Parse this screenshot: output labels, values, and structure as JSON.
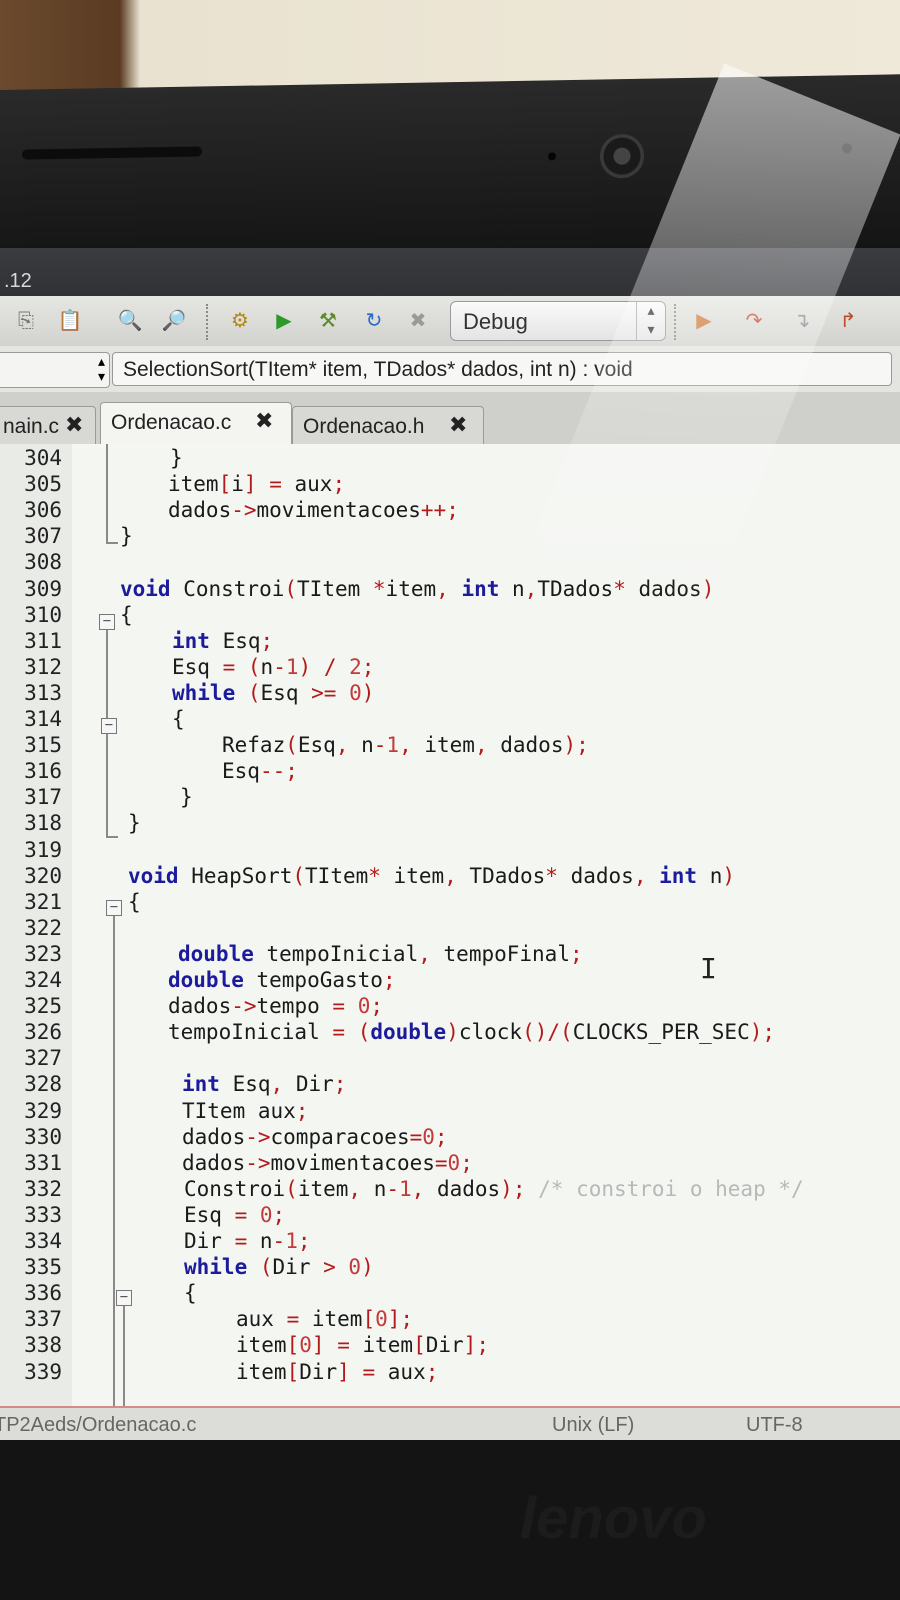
{
  "window": {
    "title_fragment": ".12"
  },
  "toolbar": {
    "build_config": "Debug",
    "icons": [
      "copy-icon",
      "paste-icon",
      "find-icon",
      "find-in-files-icon",
      "build-icon",
      "run-icon",
      "build-run-icon",
      "rebuild-icon",
      "stop-icon",
      "debug-run-icon",
      "step-icon",
      "step-into-icon",
      "step-out-icon"
    ]
  },
  "navigator": {
    "function_signature": "SelectionSort(TItem* item, TDados* dados, int n) : void"
  },
  "tabs": [
    {
      "label": "nain.c",
      "active": false
    },
    {
      "label": "Ordenacao.c",
      "active": true
    },
    {
      "label": "Ordenacao.h",
      "active": false
    }
  ],
  "editor": {
    "lines": [
      {
        "n": "304",
        "text": "}"
      },
      {
        "n": "305",
        "text": "item[i] = aux;"
      },
      {
        "n": "306",
        "text": "dados->movimentacoes++;"
      },
      {
        "n": "307",
        "text": "}"
      },
      {
        "n": "308",
        "text": ""
      },
      {
        "n": "309",
        "text": "void Constroi(TItem *item, int n,TDados* dados)"
      },
      {
        "n": "310",
        "text": "{"
      },
      {
        "n": "311",
        "text": "int Esq;"
      },
      {
        "n": "312",
        "text": "Esq = (n-1) / 2;"
      },
      {
        "n": "313",
        "text": "while (Esq >= 0)"
      },
      {
        "n": "314",
        "text": "{"
      },
      {
        "n": "315",
        "text": "Refaz(Esq, n-1, item, dados);"
      },
      {
        "n": "316",
        "text": "Esq--;"
      },
      {
        "n": "317",
        "text": "}"
      },
      {
        "n": "318",
        "text": "}"
      },
      {
        "n": "319",
        "text": ""
      },
      {
        "n": "320",
        "text": "void HeapSort(TItem* item, TDados* dados, int n)"
      },
      {
        "n": "321",
        "text": "{"
      },
      {
        "n": "322",
        "text": ""
      },
      {
        "n": "323",
        "text": "double tempoInicial, tempoFinal;"
      },
      {
        "n": "324",
        "text": "double tempoGasto;"
      },
      {
        "n": "325",
        "text": "dados->tempo = 0;"
      },
      {
        "n": "326",
        "text": "tempoInicial = (double)clock()/(CLOCKS_PER_SEC);"
      },
      {
        "n": "327",
        "text": ""
      },
      {
        "n": "328",
        "text": "int Esq, Dir;"
      },
      {
        "n": "329",
        "text": "TItem aux;"
      },
      {
        "n": "330",
        "text": "dados->comparacoes=0;"
      },
      {
        "n": "331",
        "text": "dados->movimentacoes=0;"
      },
      {
        "n": "332",
        "text": "Constroi(item, n-1, dados); /* constroi o heap */"
      },
      {
        "n": "333",
        "text": "Esq = 0;"
      },
      {
        "n": "334",
        "text": "Dir = n-1;"
      },
      {
        "n": "335",
        "text": "while (Dir > 0)"
      },
      {
        "n": "336",
        "text": "{"
      },
      {
        "n": "337",
        "text": "aux = item[0];"
      },
      {
        "n": "338",
        "text": "item[0] = item[Dir];"
      },
      {
        "n": "339",
        "text": "item[Dir] = aux;"
      }
    ]
  },
  "status_bar": {
    "file_path": "TP2Aeds/Ordenacao.c",
    "line_endings": "Unix (LF)",
    "encoding": "UTF-8"
  },
  "device": {
    "brand": "lenovo"
  }
}
